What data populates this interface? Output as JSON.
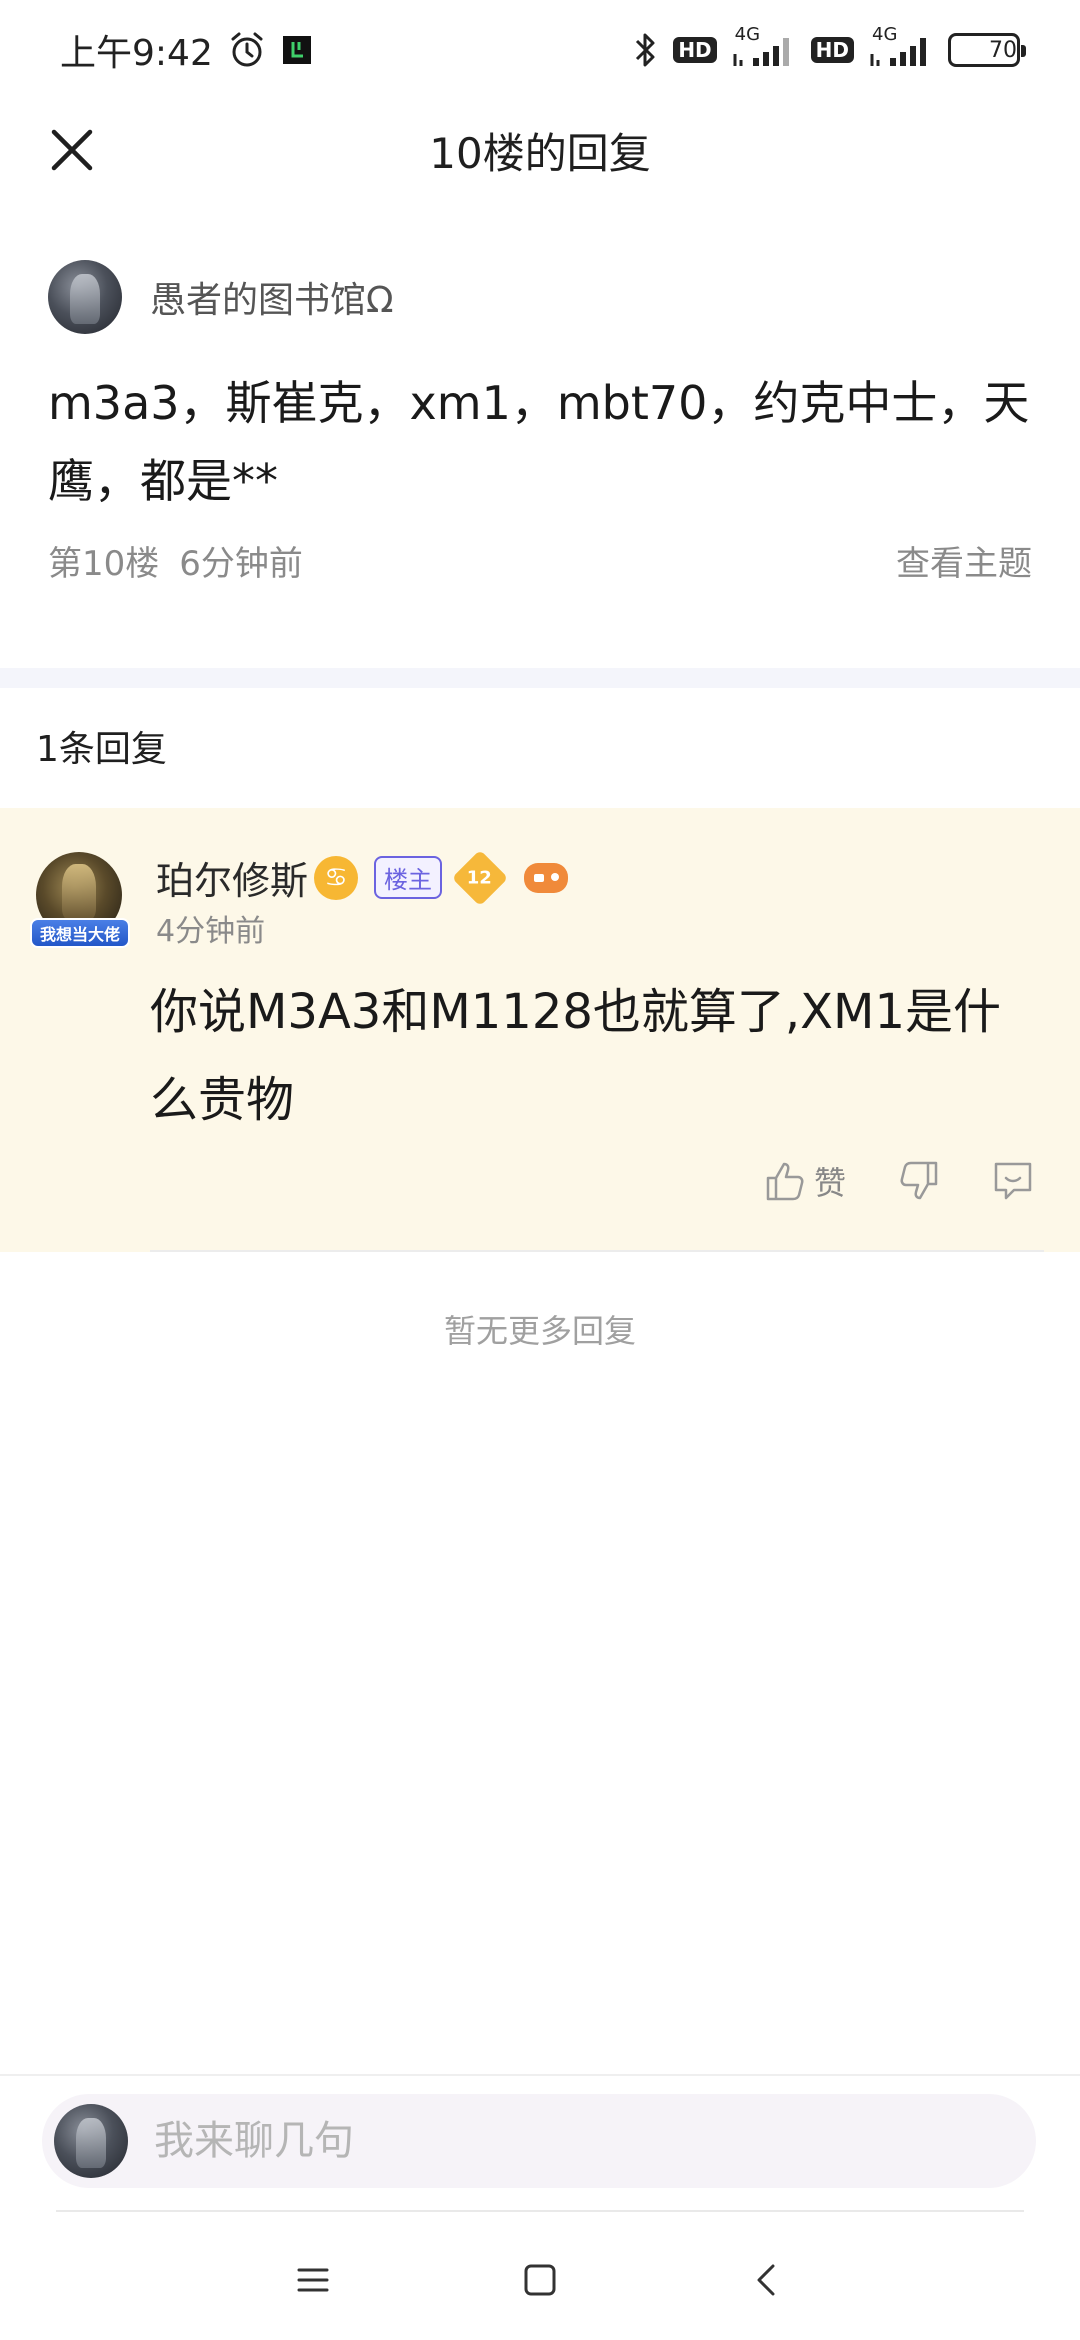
{
  "status_bar": {
    "time": "上午9:42",
    "hd1": "HD",
    "hd2": "HD",
    "net1": "4G",
    "net2": "4G",
    "battery": "70",
    "battery_level": 0.7
  },
  "header": {
    "title": "10楼的回复"
  },
  "post": {
    "author": "愚者的图书馆Ω",
    "content": "m3a3，斯崔克，xm1，mbt70，约克中士，天鹰，都是**",
    "floor": "第10楼",
    "time": "6分钟前",
    "view_topic": "查看主题"
  },
  "reply_count": "1条回复",
  "reply": {
    "name": "珀尔修斯",
    "zodiac": "♋",
    "badge": "楼主",
    "level": "12",
    "avatar_banner": "我想当大佬",
    "time": "4分钟前",
    "content": "你说M3A3和M1128也就算了,XM1是什么贵物",
    "like_label": "赞"
  },
  "no_more": "暂无更多回复",
  "input": {
    "placeholder": "我来聊几句"
  },
  "colors": {
    "reply_bg": "#fdf8e8",
    "badge_purple": "#6b63e0",
    "zodiac_gold": "#f7b733"
  }
}
